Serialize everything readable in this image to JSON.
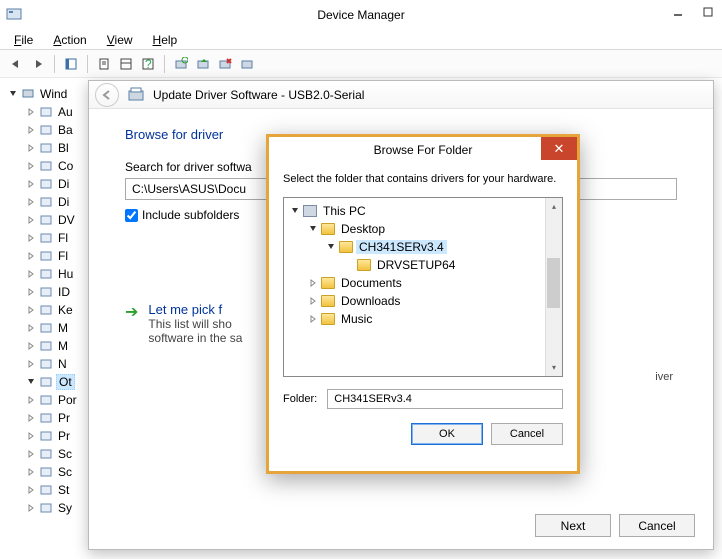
{
  "window": {
    "title": "Device Manager"
  },
  "menubar": {
    "file": "File",
    "action": "Action",
    "view": "View",
    "help": "Help"
  },
  "tree": {
    "root": "Wind",
    "items": [
      "Au",
      "Ba",
      "Bl",
      "Co",
      "Di",
      "Di",
      "DV",
      "Fl",
      "Fl",
      "Hu",
      "ID",
      "Ke",
      "M",
      "M",
      "N",
      "Ot",
      "Por",
      "Pr",
      "Pr",
      "Sc",
      "Sc",
      "St",
      "Sy"
    ],
    "selected_index": 15
  },
  "update_window": {
    "title_prefix": "Update Driver Software -",
    "title_device": "USB2.0-Serial",
    "browse_heading": "Browse for driver",
    "search_label": "Search for driver softwa",
    "path_value": "C:\\Users\\ASUS\\Docu",
    "include_subfolders_label": "Include subfolders",
    "include_subfolders_checked": true,
    "letme_title": "Let me pick f",
    "letme_sub_line1": "This list will sho",
    "letme_sub_line2": "software in the sa",
    "letme_right_fragment": "iver",
    "next_label": "Next",
    "cancel_label": "Cancel"
  },
  "browse_dialog": {
    "title": "Browse For Folder",
    "instruction": "Select the folder that contains drivers for your hardware.",
    "tree": [
      {
        "label": "This PC",
        "level": 0,
        "expanded": true,
        "icon": "pc"
      },
      {
        "label": "Desktop",
        "level": 1,
        "expanded": true,
        "icon": "folder"
      },
      {
        "label": "CH341SERv3.4",
        "level": 2,
        "expanded": true,
        "icon": "folder",
        "selected": true
      },
      {
        "label": "DRVSETUP64",
        "level": 3,
        "expanded": false,
        "icon": "folder",
        "leaf": true
      },
      {
        "label": "Documents",
        "level": 1,
        "expanded": false,
        "icon": "folder"
      },
      {
        "label": "Downloads",
        "level": 1,
        "expanded": false,
        "icon": "folder"
      },
      {
        "label": "Music",
        "level": 1,
        "expanded": false,
        "icon": "folder"
      }
    ],
    "folder_label": "Folder:",
    "folder_value": "CH341SERv3.4",
    "ok_label": "OK",
    "cancel_label": "Cancel"
  }
}
